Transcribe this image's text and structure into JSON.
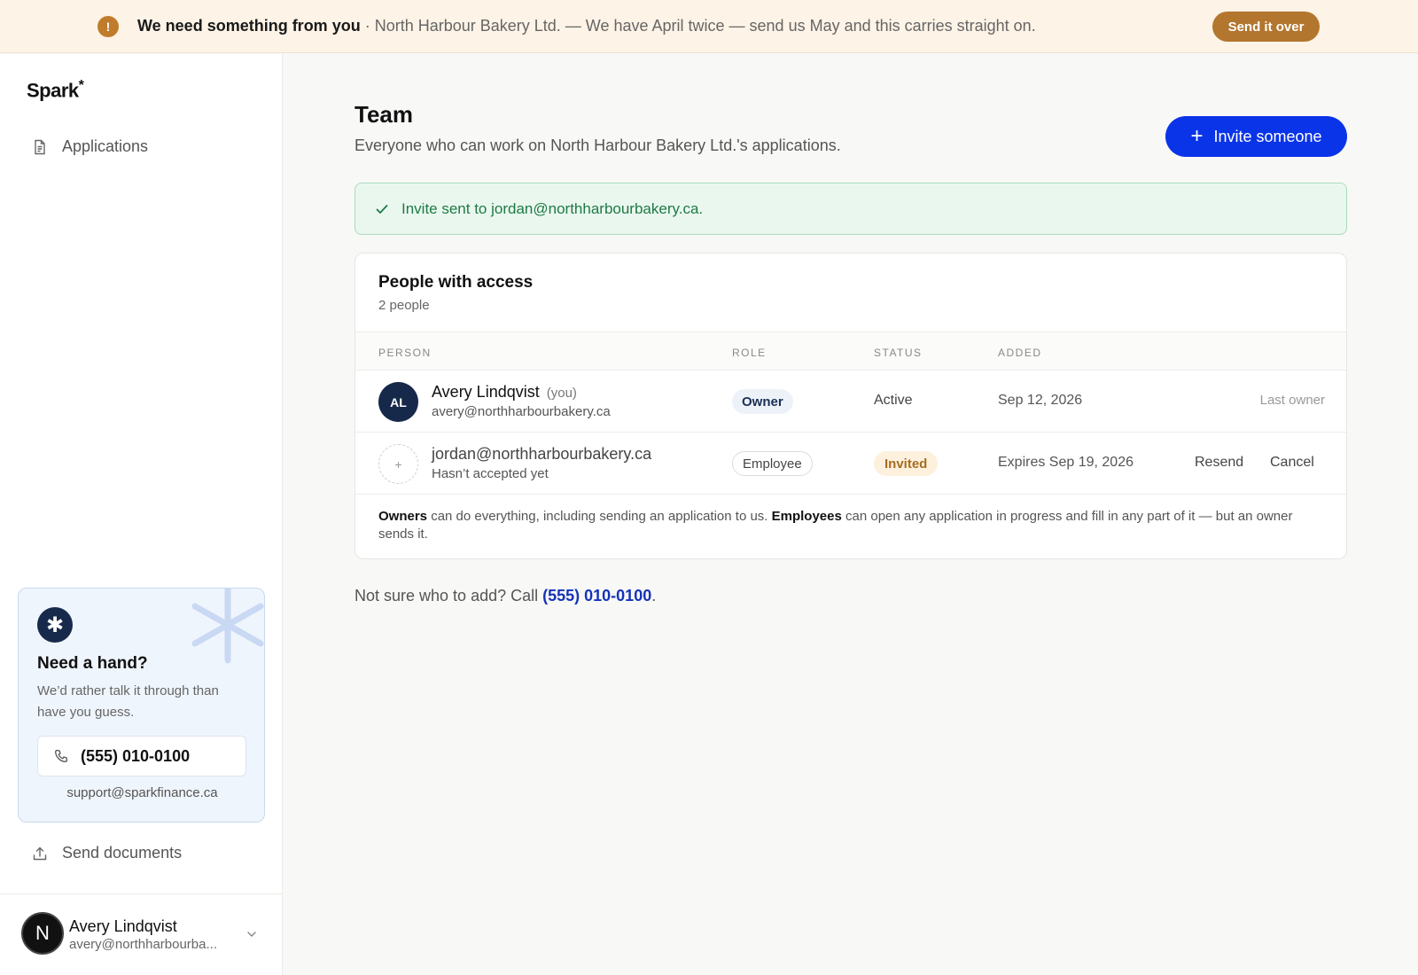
{
  "banner": {
    "title": "We need something from you",
    "separator": " · ",
    "message": "North Harbour Bakery Ltd. — We have April twice — send us May and this carries straight on.",
    "action_label": "Send it over",
    "icon": "exclamation-icon",
    "color": "#b3762e"
  },
  "sidebar": {
    "logo": "Spark",
    "logo_mark": "*",
    "nav": [
      {
        "label": "Applications",
        "icon": "document-icon"
      }
    ],
    "help": {
      "title": "Need a hand?",
      "body": "We’d rather talk it through than have you guess.",
      "phone": "(555) 010-0100",
      "email": "support@sparkfinance.ca"
    },
    "send_documents": "Send documents",
    "user": {
      "initial": "N",
      "name": "Avery Lindqvist",
      "email": "avery@northharbourba..."
    }
  },
  "main": {
    "title": "Team",
    "subtitle": "Everyone who can work on North Harbour Bakery Ltd.'s applications.",
    "invite_label": "Invite someone",
    "alert": "Invite sent to jordan@northharbourbakery.ca.",
    "card": {
      "title": "People with access",
      "count": "2 people",
      "columns": [
        "PERSON",
        "ROLE",
        "STATUS",
        "ADDED"
      ],
      "rows": [
        {
          "initials": "AL",
          "name": "Avery Lindqvist",
          "you": "(you)",
          "email": "avery@northharbourbakery.ca",
          "role": "Owner",
          "status": "Active",
          "added": "Sep 12, 2026",
          "note": "Last owner"
        },
        {
          "initials": "+",
          "name": "jordan@northharbourbakery.ca",
          "email": "Hasn’t accepted yet",
          "role": "Employee",
          "status": "Invited",
          "added": "Expires Sep 19, 2026",
          "actions": [
            "Resend",
            "Cancel"
          ]
        }
      ],
      "note": {
        "owners": "Owners",
        "owners_text": " can do everything, including sending an application to us. ",
        "employees": "Employees",
        "employees_text": " can open any application in progress and fill in any part of it — but an owner sends it."
      }
    },
    "footer": {
      "text": "Not sure who to add? Call ",
      "phone": "(555) 010-0100",
      "end": "."
    }
  },
  "colors": {
    "accent": "#0a34e8",
    "success": "#1e7a45",
    "warning": "#b3762e",
    "navy": "#17294a"
  }
}
